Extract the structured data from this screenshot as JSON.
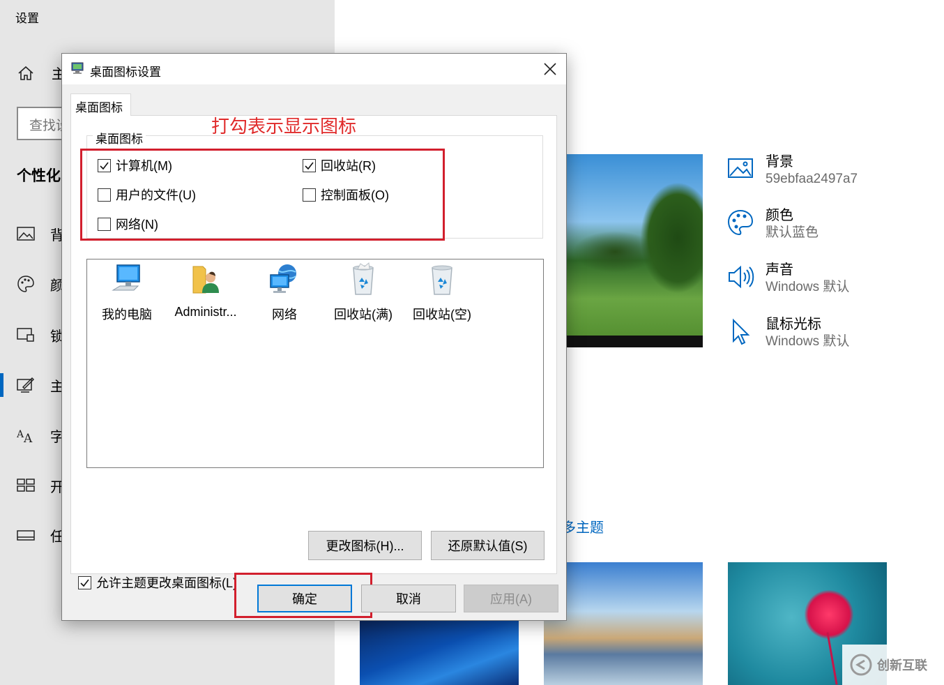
{
  "settings": {
    "app_title": "设置",
    "home_label": "主",
    "search_placeholder": "查找设",
    "section_title": "个性化",
    "nav": [
      {
        "label": "背",
        "icon": "image-icon"
      },
      {
        "label": "颜",
        "icon": "palette-icon"
      },
      {
        "label": "锁",
        "icon": "lock-screen-icon"
      },
      {
        "label": "主",
        "icon": "theme-brush-icon",
        "active": true
      },
      {
        "label": "字",
        "icon": "font-icon"
      },
      {
        "label": "开",
        "icon": "start-tiles-icon"
      },
      {
        "label": "任",
        "icon": "taskbar-icon"
      }
    ],
    "accent_color": "#0067c0"
  },
  "theme_props": [
    {
      "title": "背景",
      "value": "59ebfaa2497a7",
      "icon": "image-icon"
    },
    {
      "title": "颜色",
      "value": "默认蓝色",
      "icon": "palette-icon"
    },
    {
      "title": "声音",
      "value": "Windows 默认",
      "icon": "speaker-icon"
    },
    {
      "title": "鼠标光标",
      "value": "Windows 默认",
      "icon": "cursor-icon"
    }
  ],
  "more_themes": "多主题",
  "watermark_text": "创新互联",
  "dialog": {
    "title": "桌面图标设置",
    "tab_label": "桌面图标",
    "group_label": "桌面图标",
    "annotation": "打勾表示显示图标",
    "checkboxes": [
      {
        "label": "计算机(M)",
        "checked": true
      },
      {
        "label": "回收站(R)",
        "checked": true
      },
      {
        "label": "用户的文件(U)",
        "checked": false
      },
      {
        "label": "控制面板(O)",
        "checked": false
      },
      {
        "label": "网络(N)",
        "checked": false
      }
    ],
    "icons": [
      {
        "label": "我的电脑",
        "icon": "computer-icon"
      },
      {
        "label": "Administr...",
        "icon": "user-folder-icon"
      },
      {
        "label": "网络",
        "icon": "network-globe-icon"
      },
      {
        "label": "回收站(满)",
        "icon": "recycle-bin-full-icon"
      },
      {
        "label": "回收站(空)",
        "icon": "recycle-bin-empty-icon"
      }
    ],
    "change_icon_button": "更改图标(H)...",
    "restore_default_button": "还原默认值(S)",
    "allow_themes_checkbox": {
      "label": "允许主题更改桌面图标(L)",
      "checked": true
    },
    "ok_button": "确定",
    "cancel_button": "取消",
    "apply_button": "应用(A)",
    "annotation_color": "#d21f2d"
  }
}
